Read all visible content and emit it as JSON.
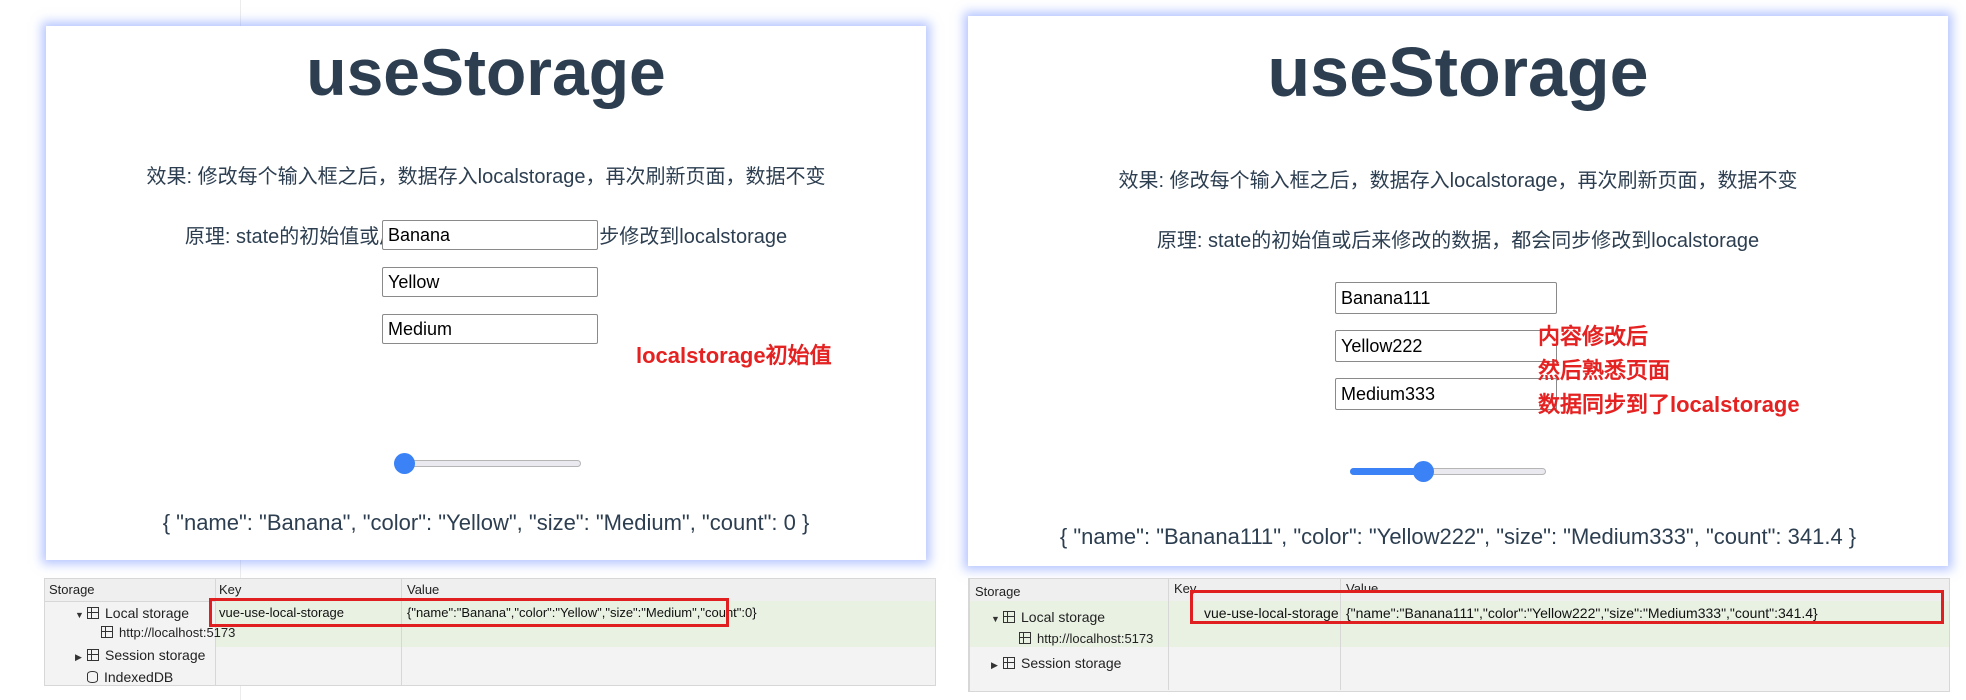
{
  "left": {
    "title": "useStorage",
    "effect_text": "效果: 修改每个输入框之后，数据存入localstorage，再次刷新页面，数据不变",
    "principle_text": "原理: state的初始值或后来修改的数据，都会同步修改到localstorage",
    "inputs": {
      "name": "Banana",
      "color": "Yellow",
      "size": "Medium"
    },
    "count": 0,
    "json_text": "{ \"name\": \"Banana\", \"color\": \"Yellow\", \"size\": \"Medium\", \"count\": 0 }",
    "note_lines": [
      "localstorage初始值"
    ],
    "devtools": {
      "headers": {
        "storage": "Storage",
        "key": "Key",
        "value": "Value"
      },
      "tree": {
        "local_storage": "Local storage",
        "origin": "http://localhost:5173",
        "session_storage": "Session storage",
        "indexeddb": "IndexedDB"
      },
      "row": {
        "key": "vue-use-local-storage",
        "value": "{\"name\":\"Banana\",\"color\":\"Yellow\",\"size\":\"Medium\",\"count\":0}"
      }
    }
  },
  "right": {
    "title": "useStorage",
    "effect_text": "效果: 修改每个输入框之后，数据存入localstorage，再次刷新页面，数据不变",
    "principle_text": "原理: state的初始值或后来修改的数据，都会同步修改到localstorage",
    "inputs": {
      "name": "Banana111",
      "color": "Yellow222",
      "size": "Medium333"
    },
    "count": 341.4,
    "json_text": "{ \"name\": \"Banana111\", \"color\": \"Yellow222\", \"size\": \"Medium333\", \"count\": 341.4 }",
    "note_lines": [
      "内容修改后",
      "然后熟悉页面",
      "数据同步到了localstorage"
    ],
    "devtools": {
      "headers": {
        "storage": "Storage",
        "key": "Key",
        "value": "Value"
      },
      "tree": {
        "local_storage": "Local storage",
        "origin": "http://localhost:5173",
        "session_storage": "Session storage"
      },
      "row": {
        "key": "vue-use-local-storage",
        "value": "{\"name\":\"Banana111\",\"color\":\"Yellow222\",\"size\":\"Medium333\",\"count\":341.4}"
      }
    }
  },
  "colors": {
    "accent": "#3b82f6",
    "annotation": "#e52222",
    "text": "#2c3e50",
    "glow": "#7896ff"
  },
  "slider_level": {
    "left": 0.0,
    "right": 0.37
  }
}
